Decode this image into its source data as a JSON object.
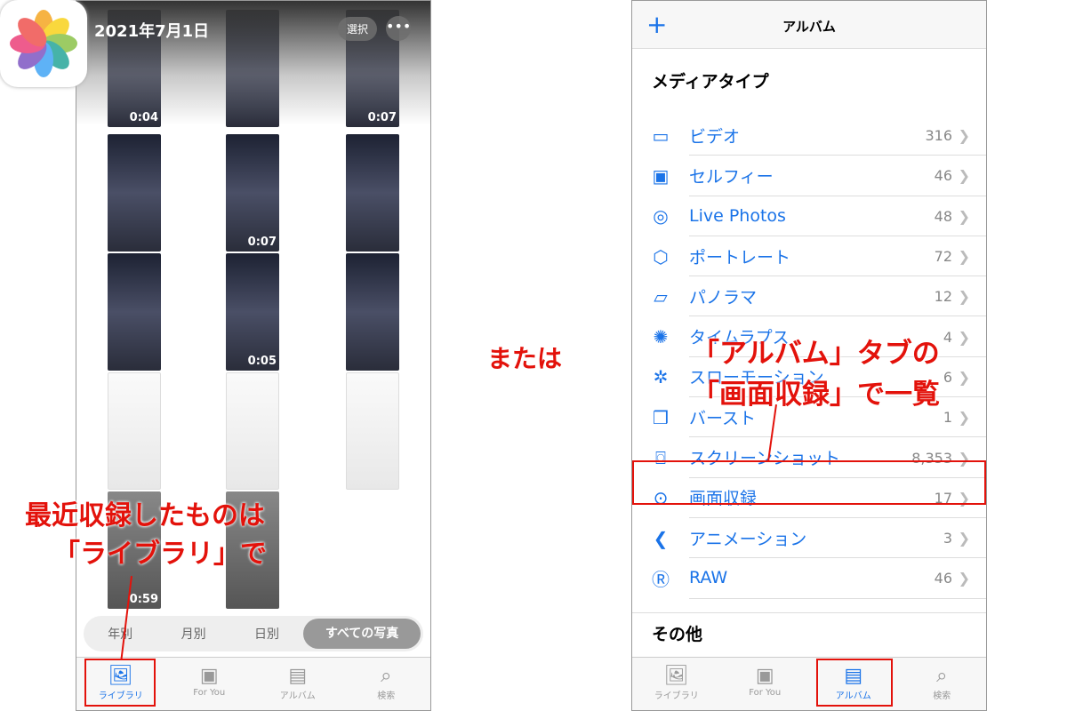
{
  "left_phone": {
    "date": "2021年7月1日",
    "select": "選択",
    "more": "•••",
    "durations": [
      "0:04",
      "0:07",
      "0:07",
      "0:05",
      "0:59"
    ],
    "segments": [
      "年別",
      "月別",
      "日別",
      "すべての写真"
    ],
    "tabs": [
      {
        "label": "ライブラリ",
        "icon": "photo-library-icon"
      },
      {
        "label": "For You",
        "icon": "for-you-icon"
      },
      {
        "label": "アルバム",
        "icon": "album-icon"
      },
      {
        "label": "検索",
        "icon": "search-icon"
      }
    ]
  },
  "right_phone": {
    "title": "アルバム",
    "add": "+",
    "section": "メディアタイプ",
    "items": [
      {
        "label": "ビデオ",
        "count": "316",
        "icon": "video-icon"
      },
      {
        "label": "セルフィー",
        "count": "46",
        "icon": "selfie-icon"
      },
      {
        "label": "Live Photos",
        "count": "48",
        "icon": "live-photos-icon"
      },
      {
        "label": "ポートレート",
        "count": "72",
        "icon": "portrait-icon"
      },
      {
        "label": "パノラマ",
        "count": "12",
        "icon": "panorama-icon"
      },
      {
        "label": "タイムラプス",
        "count": "4",
        "icon": "timelapse-icon"
      },
      {
        "label": "スローモーション",
        "count": "6",
        "icon": "slowmo-icon"
      },
      {
        "label": "バースト",
        "count": "1",
        "icon": "burst-icon"
      },
      {
        "label": "スクリーンショット",
        "count": "8,353",
        "icon": "screenshot-icon"
      },
      {
        "label": "画面収録",
        "count": "17",
        "icon": "screen-recording-icon"
      },
      {
        "label": "アニメーション",
        "count": "3",
        "icon": "animation-icon"
      },
      {
        "label": "RAW",
        "count": "46",
        "icon": "raw-icon"
      }
    ],
    "other_section": "その他",
    "tabs": [
      {
        "label": "ライブラリ"
      },
      {
        "label": "For You"
      },
      {
        "label": "アルバム"
      },
      {
        "label": "検索"
      }
    ]
  },
  "annotations": {
    "or": "または",
    "left_line1": "最近収録したものは",
    "left_line2": "「ライブラリ」で",
    "right_line1": "「アルバム」タブの",
    "right_line2": "「画面収録」で一覧"
  },
  "colors": {
    "accent": "#1a73e8",
    "annotation": "#e3120b"
  }
}
